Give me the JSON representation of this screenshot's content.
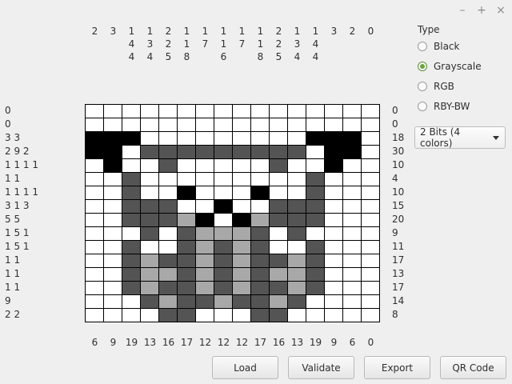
{
  "window_controls": [
    "–",
    "+",
    "×"
  ],
  "col_clues_top": [
    [
      "2"
    ],
    [
      "3"
    ],
    [
      "1",
      "4",
      "4"
    ],
    [
      "1",
      "3",
      "4"
    ],
    [
      "2",
      "2",
      "5"
    ],
    [
      "1",
      "1",
      "8"
    ],
    [
      "1",
      "7"
    ],
    [
      "1",
      "1",
      "6"
    ],
    [
      "1",
      "7"
    ],
    [
      "1",
      "1",
      "8"
    ],
    [
      "2",
      "2",
      "5"
    ],
    [
      "1",
      "3",
      "4"
    ],
    [
      "1",
      "4",
      "4"
    ],
    [
      "3"
    ],
    [
      "2"
    ],
    [
      "0"
    ]
  ],
  "row_clues_left": [
    "0",
    "0",
    "3 3",
    "2 9 2",
    "1 1 1 1",
    "1 1",
    "1 1 1 1",
    "3 1 3",
    "5 5",
    "1 5 1",
    "1 5 1",
    "1 1",
    "1 1",
    "1 1",
    "9",
    "2 2"
  ],
  "row_clues_right": [
    "0",
    "0",
    "18",
    "30",
    "10",
    "4",
    "10",
    "15",
    "20",
    "9",
    "11",
    "17",
    "13",
    "17",
    "14",
    "8"
  ],
  "col_clues_bottom": [
    "6",
    "9",
    "19",
    "13",
    "16",
    "17",
    "12",
    "12",
    "12",
    "17",
    "16",
    "13",
    "19",
    "9",
    "6",
    "0"
  ],
  "grid": [
    [
      0,
      0,
      0,
      0,
      0,
      0,
      0,
      0,
      0,
      0,
      0,
      0,
      0,
      0,
      0,
      0
    ],
    [
      0,
      0,
      0,
      0,
      0,
      0,
      0,
      0,
      0,
      0,
      0,
      0,
      0,
      0,
      0,
      0
    ],
    [
      3,
      3,
      3,
      0,
      0,
      0,
      0,
      0,
      0,
      0,
      0,
      0,
      3,
      3,
      3,
      0
    ],
    [
      3,
      3,
      0,
      2,
      2,
      2,
      2,
      2,
      2,
      2,
      2,
      2,
      0,
      3,
      3,
      0
    ],
    [
      0,
      3,
      0,
      0,
      2,
      0,
      0,
      0,
      0,
      0,
      2,
      0,
      0,
      3,
      0,
      0
    ],
    [
      0,
      0,
      2,
      0,
      0,
      0,
      0,
      0,
      0,
      0,
      0,
      0,
      2,
      0,
      0,
      0
    ],
    [
      0,
      0,
      2,
      0,
      0,
      3,
      0,
      0,
      0,
      3,
      0,
      0,
      2,
      0,
      0,
      0
    ],
    [
      0,
      0,
      2,
      2,
      2,
      0,
      0,
      3,
      0,
      0,
      2,
      2,
      2,
      0,
      0,
      0
    ],
    [
      0,
      0,
      2,
      2,
      2,
      1,
      3,
      0,
      3,
      1,
      2,
      2,
      2,
      0,
      0,
      0
    ],
    [
      0,
      0,
      0,
      2,
      0,
      2,
      1,
      1,
      1,
      2,
      0,
      2,
      0,
      0,
      0,
      0
    ],
    [
      0,
      0,
      2,
      0,
      0,
      2,
      1,
      2,
      1,
      2,
      0,
      0,
      2,
      0,
      0,
      0
    ],
    [
      0,
      0,
      2,
      1,
      2,
      2,
      1,
      2,
      1,
      2,
      2,
      1,
      2,
      0,
      0,
      0
    ],
    [
      0,
      0,
      2,
      1,
      1,
      2,
      1,
      2,
      1,
      2,
      1,
      1,
      2,
      0,
      0,
      0
    ],
    [
      0,
      0,
      2,
      1,
      2,
      2,
      1,
      2,
      1,
      2,
      2,
      1,
      2,
      0,
      0,
      0
    ],
    [
      0,
      0,
      0,
      2,
      1,
      2,
      2,
      1,
      2,
      2,
      1,
      2,
      0,
      0,
      0,
      0
    ],
    [
      0,
      0,
      0,
      0,
      2,
      2,
      0,
      0,
      0,
      2,
      2,
      0,
      0,
      0,
      0,
      0
    ]
  ],
  "type_panel": {
    "title": "Type",
    "options": [
      "Black",
      "Grayscale",
      "RGB",
      "RBY-BW"
    ],
    "selected": "Grayscale"
  },
  "bits_select": {
    "value": "2 Bits (4 colors)"
  },
  "buttons": {
    "load": "Load",
    "validate": "Validate",
    "export": "Export",
    "qrcode": "QR Code"
  },
  "colors": {
    "white": "#ffffff",
    "light_gray": "#a8a8a8",
    "dark_gray": "#545454",
    "black": "#000000",
    "accent": "#6ea33f"
  }
}
